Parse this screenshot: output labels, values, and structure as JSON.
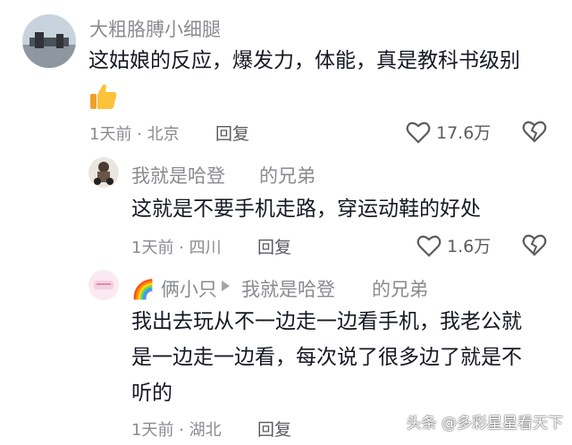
{
  "comments": [
    {
      "username": "大粗胳膊小细腿",
      "text": "这姑娘的反应，爆发力，体能，真是教科书级别",
      "emoji": "thumbs-up",
      "time_location": "1天前 · 北京",
      "reply_label": "回复",
      "likes": "17.6万"
    },
    {
      "username": "我就是哈登",
      "username_suffix": "的兄弟",
      "text": "这就是不要手机走路，穿运动鞋的好处",
      "time_location": "1天前 · 四川",
      "reply_label": "回复",
      "likes": "1.6万"
    },
    {
      "username": "🌈 俩小只",
      "reply_to": "我就是哈登",
      "reply_to_suffix": "的兄弟",
      "text_lines": [
        "我出去玩从不一边走一边看手机，我老公就",
        "是一边走一边看，每次说了很多边了就是不",
        "听的"
      ],
      "time_location": "1天前 · 湖北",
      "reply_label": "回复"
    }
  ],
  "watermark": "头条 @多彩星星看天下",
  "colors": {
    "text": "#161823",
    "secondary": "#8a8b91",
    "icon": "#5a5b61"
  }
}
